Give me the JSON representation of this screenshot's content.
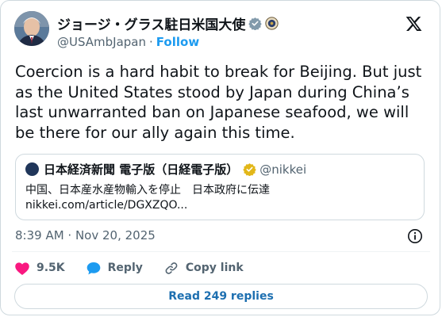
{
  "author": {
    "display_name": "ジョージ・グラス駐日米国大使",
    "handle": "@USAmbJapan",
    "separator": "·",
    "follow_label": "Follow"
  },
  "post": {
    "text": "Coercion is a hard habit to break for Beijing. But just as the United States stood by Japan during China’s last unwarranted ban on Japanese seafood, we will be there for our ally again this time.",
    "timestamp": "8:39 AM · Nov 20, 2025"
  },
  "quote": {
    "source_name": "日本経済新聞 電子版（日経電子版）",
    "source_handle": "@nikkei",
    "headline": "中国、日本産水産物輸入を停止　日本政府に伝達",
    "link_text": "nikkei.com/article/DGXZQO..."
  },
  "actions": {
    "like_count": "9.5K",
    "reply_label": "Reply",
    "copy_link_label": "Copy link",
    "read_replies_label": "Read 249 replies"
  },
  "icons": {
    "verified": "verified-badge-icon",
    "seal": "government-seal-icon",
    "x_logo": "x-logo-icon",
    "gold_check": "gold-verified-badge-icon",
    "info": "info-icon",
    "like": "heart-icon",
    "reply": "speech-bubble-icon",
    "link": "link-icon"
  },
  "colors": {
    "accent": "#1d9bf0",
    "like": "#f91880",
    "text": "#0f1419",
    "muted": "#536471",
    "border": "#cfd9de"
  }
}
